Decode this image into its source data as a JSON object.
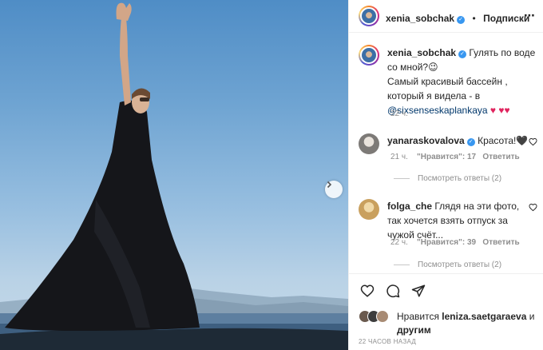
{
  "header": {
    "username": "xenia_sobchak",
    "separator": "•",
    "follow_label": "Подписки",
    "more_icon": "more-dots-icon"
  },
  "caption": {
    "username": "xenia_sobchak",
    "text_part1": "Гулять по воде со мной?😉",
    "text_part2": "Самый красивый бассейн , который я видела - в ",
    "mention": "@sixsenseskaplankaya",
    "hearts": "♥ ♥♥",
    "time": "22 ч."
  },
  "comments": [
    {
      "username": "yanaraskovalova",
      "text": "Красота!🖤",
      "time": "21 ч.",
      "likes": "\"Нравится\": 17",
      "reply_label": "Ответить",
      "view_replies": "Посмотреть ответы (2)"
    },
    {
      "username": "folga_che",
      "text": "Глядя на эти фото, так хочется взять отпуск за чужой счёт...",
      "time": "22 ч.",
      "likes": "\"Нравится\": 39",
      "reply_label": "Ответить",
      "view_replies": "Посмотреть ответы (2)"
    }
  ],
  "likes": {
    "prefix": "Нравится",
    "user": "leniza.saetgaraeva",
    "and": "и",
    "others": "другим"
  },
  "timestamp": "22 ЧАСОВ НАЗАД",
  "colors": {
    "link": "#00376b",
    "verified": "#3897f0",
    "heart": "#e0245e",
    "muted": "#8e8e8e"
  }
}
